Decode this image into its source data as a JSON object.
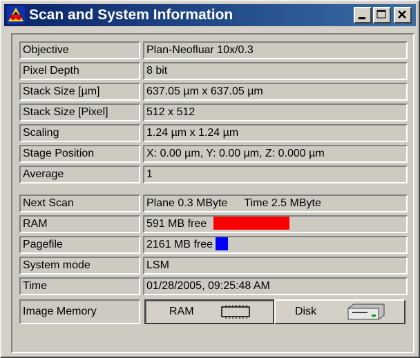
{
  "window": {
    "title": "Scan and System Information",
    "app_icon": "lsm-logo-icon",
    "controls": [
      "minimize-icon",
      "maximize-icon",
      "close-icon"
    ]
  },
  "info_rows": [
    {
      "label": "Objective",
      "value": "Plan-Neofluar 10x/0.3"
    },
    {
      "label": "Pixel Depth",
      "value": "8 bit"
    },
    {
      "label": "Stack Size [µm]",
      "value": "637.05 µm  x  637.05 µm"
    },
    {
      "label": "Stack Size [Pixel]",
      "value": "512  x  512"
    },
    {
      "label": "Scaling",
      "value": "1.24 µm  x  1.24 µm"
    },
    {
      "label": "Stage Position",
      "value": "X: 0.00 µm,  Y: 0.00 µm,  Z: 0.000 µm"
    },
    {
      "label": "Average",
      "value": "1"
    }
  ],
  "system_rows": {
    "next_scan": {
      "label": "Next Scan",
      "plane": "Plane 0.3 MByte",
      "time": "Time 2.5 MByte"
    },
    "ram": {
      "label": "RAM",
      "value": "591 MB free",
      "bar_color": "#ff0000"
    },
    "pagefile": {
      "label": "Pagefile",
      "value": "2161 MB free",
      "bar_color": "#0000ff"
    },
    "system_mode": {
      "label": "System mode",
      "value": "LSM"
    },
    "time": {
      "label": "Time",
      "value": "01/28/2005, 09:25:48 AM"
    }
  },
  "image_memory": {
    "label": "Image Memory",
    "options": [
      {
        "label": "RAM",
        "icon": "memory-chip-icon",
        "selected": true
      },
      {
        "label": "Disk",
        "icon": "disk-drive-icon",
        "selected": false
      }
    ]
  }
}
